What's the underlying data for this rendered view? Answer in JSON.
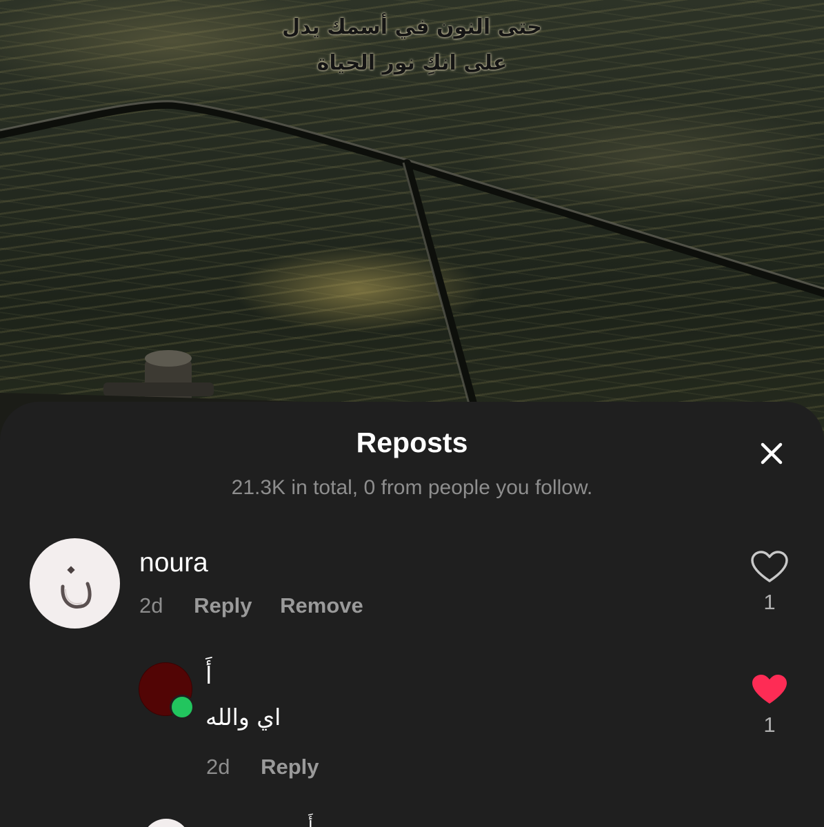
{
  "video": {
    "caption_lines": [
      "حتى النون في أسمك يدل",
      "على انكِ نور الحياة"
    ]
  },
  "sheet": {
    "title": "Reposts",
    "subtitle": "21.3K in total, 0 from people you follow.",
    "close_icon": "close-icon"
  },
  "comments": [
    {
      "username": "noura",
      "avatar_glyph": "ن",
      "time": "2d",
      "reply_label": "Reply",
      "remove_label": "Remove",
      "like_icon": "heart-outline-icon",
      "like_count": "1",
      "liked": false
    }
  ],
  "replies": [
    {
      "username": "أَ",
      "text": "اي والله",
      "time": "2d",
      "reply_label": "Reply",
      "like_icon": "heart-filled-icon",
      "like_count": "1",
      "liked": true,
      "online": true
    }
  ],
  "peek": {
    "username": "أَ"
  },
  "colors": {
    "sheet_bg": "#1f1f1f",
    "muted_text": "#8e8e8e",
    "like_red": "#fe2c55",
    "online_green": "#22c55e"
  }
}
